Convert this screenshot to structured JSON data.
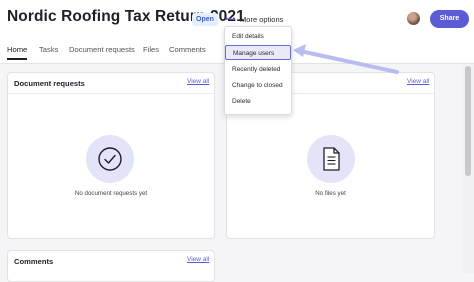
{
  "header": {
    "title": "Nordic Roofing Tax Return 2021",
    "status_badge": "Open",
    "more_options_label": "More options",
    "share_label": "Share"
  },
  "tabs": [
    {
      "label": "Home",
      "active": true
    },
    {
      "label": "Tasks"
    },
    {
      "label": "Document requests"
    },
    {
      "label": "Files"
    },
    {
      "label": "Comments"
    }
  ],
  "menu": {
    "items": [
      {
        "label": "Edit details"
      },
      {
        "label": "Manage users",
        "highlighted": true
      },
      {
        "label": "Recently deleted"
      },
      {
        "label": "Change to closed"
      },
      {
        "label": "Delete"
      }
    ]
  },
  "cards": {
    "document_requests": {
      "title": "Document requests",
      "view_all": "View all",
      "empty_text": "No document requests yet"
    },
    "files": {
      "view_all": "View all",
      "empty_text": "No files yet"
    },
    "comments": {
      "title": "Comments",
      "view_all": "View all"
    }
  },
  "colors": {
    "accent": "#5b5bd6",
    "badge_bg": "#e6eefc",
    "icon_circle": "#e3e4f8",
    "annotation_arrow": "#b9bcef"
  }
}
